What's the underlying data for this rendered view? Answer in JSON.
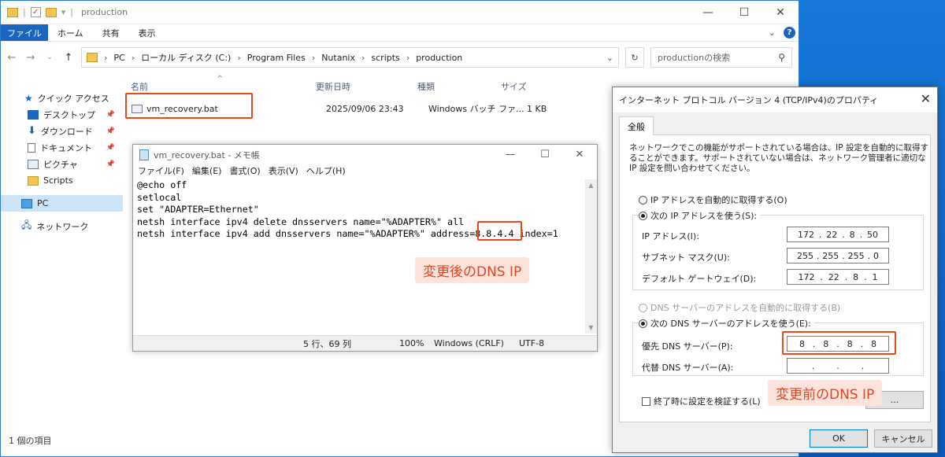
{
  "explorer": {
    "title": "production",
    "ribbon_tabs": [
      "ファイル",
      "ホーム",
      "共有",
      "表示"
    ],
    "breadcrumb": [
      "PC",
      "ローカル ディスク (C:)",
      "Program Files",
      "Nutanix",
      "scripts",
      "production"
    ],
    "search_placeholder": "productionの検索",
    "nav": {
      "quick_access": "クイック アクセス",
      "desktop": "デスクトップ",
      "downloads": "ダウンロード",
      "documents": "ドキュメント",
      "pictures": "ピクチャ",
      "scripts": "Scripts",
      "pc": "PC",
      "network": "ネットワーク"
    },
    "columns": [
      "名前",
      "更新日時",
      "種類",
      "サイズ"
    ],
    "file": {
      "name": "vm_recovery.bat",
      "modified": "2025/09/06 23:43",
      "type": "Windows バッチ ファ...",
      "size": "1 KB"
    },
    "status": "1 個の項目"
  },
  "notepad": {
    "title": "vm_recovery.bat - メモ帳",
    "menu": [
      "ファイル(F)",
      "編集(E)",
      "書式(O)",
      "表示(V)",
      "ヘルプ(H)"
    ],
    "content": "@echo off\nsetlocal\nset \"ADAPTER=Ethernet\"\nnetsh interface ipv4 delete dnsservers name=\"%ADAPTER%\" all\nnetsh interface ipv4 add dnsservers name=\"%ADAPTER%\" address=8.8.4.4 index=1",
    "status_position": "5 行、69 列",
    "status_zoom": "100%",
    "status_eol": "Windows (CRLF)",
    "status_encoding": "UTF-8"
  },
  "callouts": {
    "after": "変更後のDNS IP",
    "before": "変更前のDNS IP"
  },
  "dialog": {
    "title": "インターネット プロトコル バージョン 4 (TCP/IPv4)のプロパティ",
    "tab": "全般",
    "description": "ネットワークでこの機能がサポートされている場合は、IP 設定を自動的に取得することができます。サポートされていない場合は、ネットワーク管理者に適切な IP 設定を問い合わせてください。",
    "auto_ip": "IP アドレスを自動的に取得する(O)",
    "manual_ip": "次の IP アドレスを使う(S):",
    "ip_label": "IP アドレス(I):",
    "ip_value": [
      "172",
      "22",
      "8",
      "50"
    ],
    "subnet_label": "サブネット マスク(U):",
    "subnet_value": [
      "255",
      "255",
      "255",
      "0"
    ],
    "gateway_label": "デフォルト ゲートウェイ(D):",
    "gateway_value": [
      "172",
      "22",
      "8",
      "1"
    ],
    "auto_dns": "DNS サーバーのアドレスを自動的に取得する(B)",
    "manual_dns": "次の DNS サーバーのアドレスを使う(E):",
    "preferred_dns_label": "優先 DNS サーバー(P):",
    "preferred_dns_value": [
      "8",
      "8",
      "8",
      "8"
    ],
    "alternate_dns_label": "代替 DNS サーバー(A):",
    "alternate_dns_value": [
      "",
      "",
      "",
      ""
    ],
    "validate_on_exit": "終了時に設定を検証する(L)",
    "advanced_btn": "...",
    "ok": "OK",
    "cancel": "キャンセル"
  }
}
